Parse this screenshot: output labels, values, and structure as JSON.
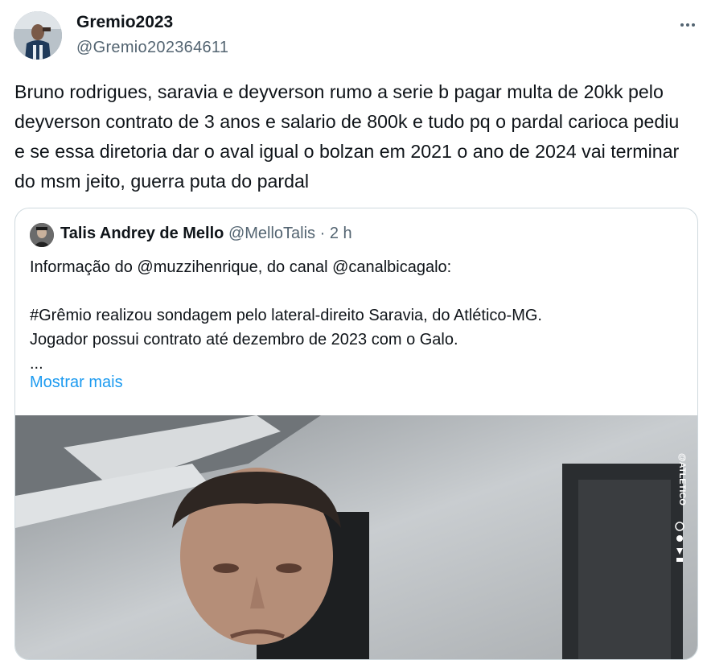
{
  "tweet": {
    "display_name": "Gremio2023",
    "handle": "@Gremio202364611",
    "text": "Bruno rodrigues, saravia e deyverson rumo a serie b pagar multa de 20kk pelo deyverson contrato de 3 anos e salario de 800k e tudo pq o pardal carioca pediu e se essa diretoria dar o aval igual o bolzan em 2021 o ano de 2024 vai terminar do msm jeito, guerra puta do pardal",
    "more_icon": "more-horizontal-icon"
  },
  "quote": {
    "display_name": "Talis Andrey de Mello",
    "handle": "@MelloTalis",
    "separator": "·",
    "time": "2 h",
    "lines": [
      "Informação do @muzzihenrique, do canal @canalbicagalo:",
      "",
      "#Grêmio realizou sondagem pelo lateral-direito Saravia, do Atlético-MG.",
      "Jogador possui contrato até dezembro de 2023 com o Galo.",
      "..."
    ],
    "show_more": "Mostrar mais",
    "watermark": "@ATLETICO"
  },
  "colors": {
    "text": "#0f1419",
    "secondary": "#536471",
    "link": "#1d9bf0",
    "border": "#cfd9de"
  }
}
